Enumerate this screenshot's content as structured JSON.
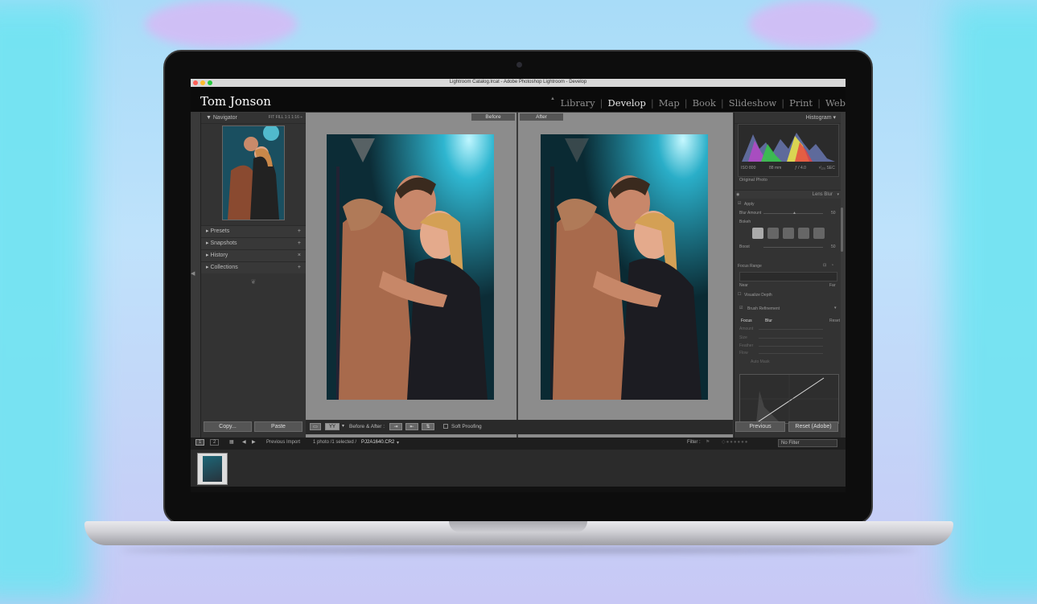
{
  "window": {
    "title": "Lightroom Catalog.lrcat - Adobe Photoshop Lightroom - Develop"
  },
  "identity_plate": "Tom Jonson",
  "modules": [
    "Library",
    "Develop",
    "Map",
    "Book",
    "Slideshow",
    "Print",
    "Web"
  ],
  "active_module": "Develop",
  "left_panel": {
    "navigator": {
      "label": "Navigator",
      "zoom_options": "FIT  FILL  1:1  1:16 ÷"
    },
    "sections": [
      {
        "label": "Presets",
        "action": "+"
      },
      {
        "label": "Snapshots",
        "action": "+"
      },
      {
        "label": "History",
        "action": "×"
      },
      {
        "label": "Collections",
        "action": "+"
      }
    ],
    "copy_button": "Copy...",
    "paste_button": "Paste"
  },
  "center": {
    "before_label": "Before",
    "after_label": "After",
    "toolbar": {
      "view_mode": "YY",
      "before_after_label": "Before & After :",
      "soft_proofing": "Soft Proofing"
    }
  },
  "right_panel": {
    "histogram": {
      "label": "Histogram",
      "iso": "ISO 800",
      "focal": "88 mm",
      "aperture": "ƒ / 4.0",
      "shutter": "¹⁄₁₂₅ SEC",
      "original_photo": "Original Photo"
    },
    "lens_blur": {
      "label": "Lens Blur",
      "apply": "Apply",
      "blur_amount_label": "Blur Amount",
      "blur_amount_value": "50",
      "bokeh_label": "Bokeh",
      "boost_label": "Boost",
      "boost_value": "50",
      "focus_range_label": "Focus Range",
      "near": "Near",
      "far": "Far",
      "visualize_depth": "Visualize Depth",
      "brush_refinement": "Brush Refinement",
      "focus_tab": "Focus",
      "blur_tab": "Blur",
      "reset": "Reset",
      "amount": "Amount",
      "size": "Size",
      "feather": "Feather",
      "flow": "Flow",
      "auto_mask": "Auto Mask"
    },
    "previous_button": "Previous",
    "reset_button": "Reset (Adobe)"
  },
  "filmstrip_bar": {
    "tab1": "1",
    "tab2": "2",
    "source": "Previous Import",
    "info": "1 photo /1 selected /",
    "filename": "PJ2A1640.CR2",
    "filter_label": "Filter :",
    "filter_value": "No Filter"
  },
  "colors": {
    "accent_bg": "#a8dcf8",
    "panel": "#333333",
    "topbar": "#0b0b0b"
  }
}
